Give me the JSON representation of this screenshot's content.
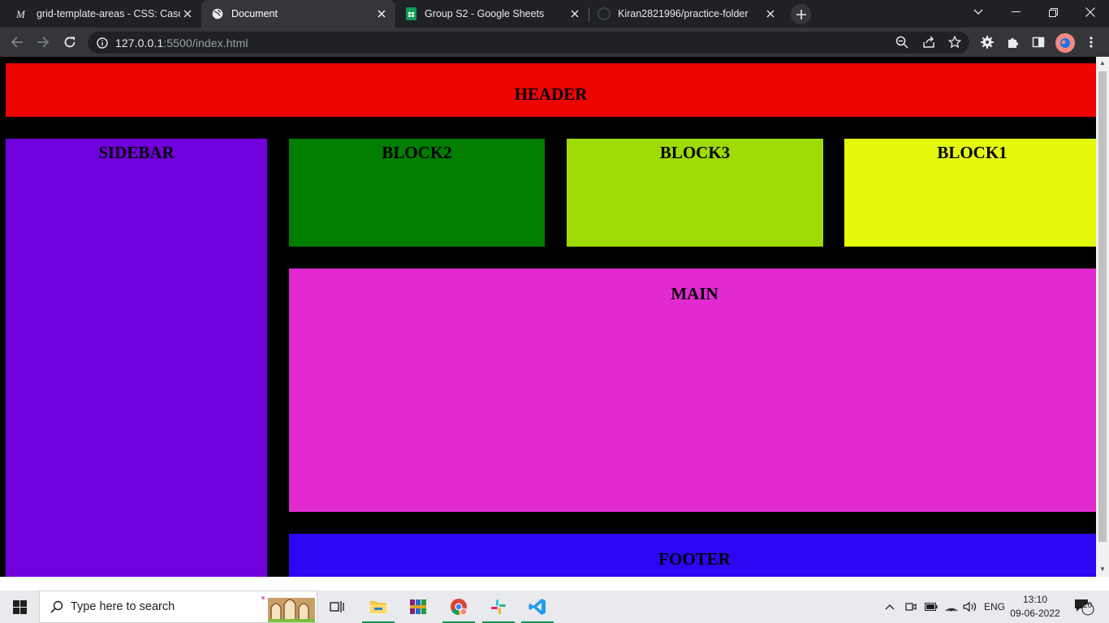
{
  "browser": {
    "tabs": [
      {
        "title": "grid-template-areas - CSS: Casca",
        "icon": "mdn-icon",
        "active": false
      },
      {
        "title": "Document",
        "icon": "globe-icon",
        "active": true
      },
      {
        "title": "Group S2 - Google Sheets",
        "icon": "sheets-icon",
        "active": false
      },
      {
        "title": "Kiran2821996/practice-folder",
        "icon": "github-icon",
        "active": false
      }
    ],
    "url_host": "127.0.0.1",
    "url_rest": ":5500/index.html"
  },
  "page": {
    "header": "HEADER",
    "sidebar": "SIDEBAR",
    "block2": "BLOCK2",
    "block3": "BLOCK3",
    "block1": "BLOCK1",
    "main": "MAIN",
    "footer": "FOOTER",
    "colors": {
      "header": "#ee0303",
      "sidebar": "#7100dc",
      "block2": "#017d00",
      "block3": "#9edb04",
      "block1": "#e4f90c",
      "main": "#e22ad1",
      "footer": "#2b07f4",
      "background": "#000000"
    }
  },
  "taskbar": {
    "search_placeholder": "Type here to search",
    "language": "ENG",
    "time": "13:10",
    "date": "09-06-2022",
    "notifications": "20"
  }
}
